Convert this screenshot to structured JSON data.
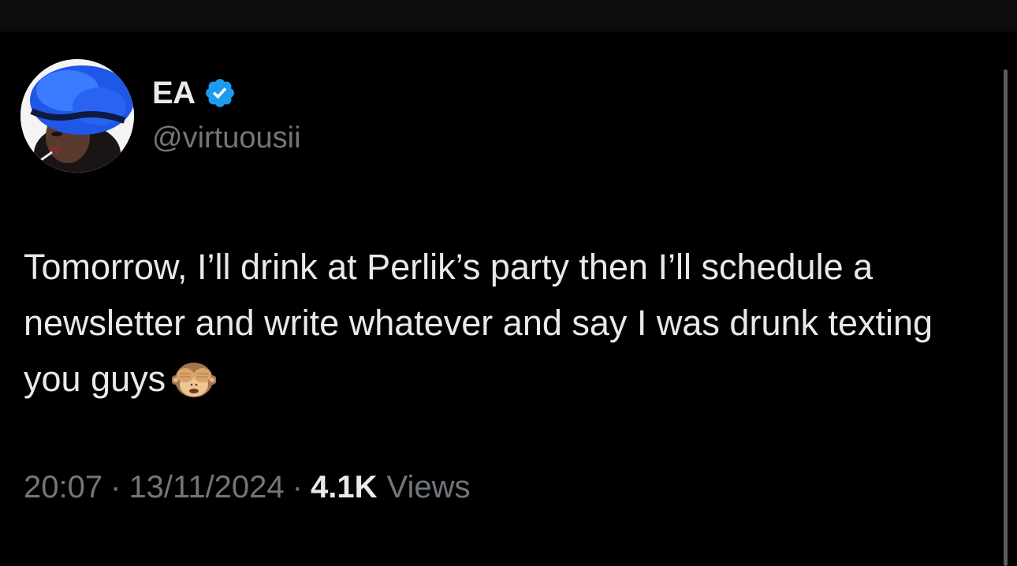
{
  "author": {
    "display_name": "EA",
    "handle": "@virtuousii",
    "verified": true,
    "badge_color": "#1d9bf0"
  },
  "tweet": {
    "text": "Tomorrow, I’ll drink at Perlik’s party then I’ll schedule a newsletter and write whatever and say I was drunk texting you guys",
    "emoji": "see-no-evil-monkey-icon"
  },
  "meta": {
    "time": "20:07",
    "separator": "·",
    "date": "13/11/2024",
    "views_count": "4.1K",
    "views_label": "Views"
  },
  "colors": {
    "background": "#000000",
    "primary_text": "#e7e9ea",
    "secondary_text": "#71767b"
  }
}
